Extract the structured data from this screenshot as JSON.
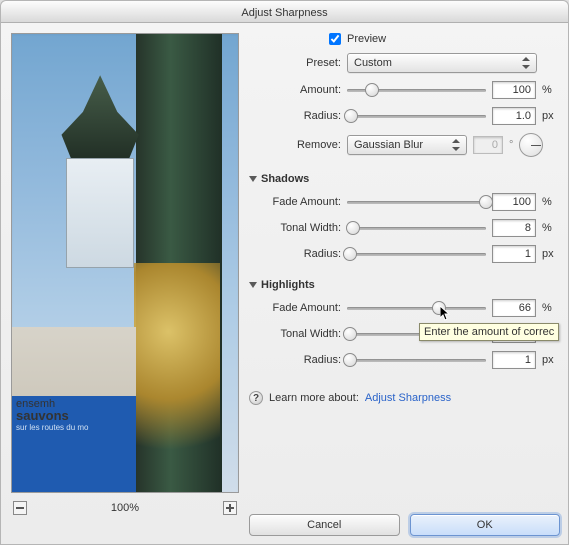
{
  "window": {
    "title": "Adjust Sharpness"
  },
  "preview": {
    "checkbox_label": "Preview",
    "banner_line1": "ensemh",
    "banner_line2": "sauvons",
    "banner_line3": "sur les routes du mo"
  },
  "zoom": {
    "level": "100%"
  },
  "preset": {
    "label": "Preset:",
    "value": "Custom"
  },
  "amount": {
    "label": "Amount:",
    "value": "100",
    "unit": "%",
    "thumb_pct": 18
  },
  "radius": {
    "label": "Radius:",
    "value": "1.0",
    "unit": "px",
    "thumb_pct": 3
  },
  "remove": {
    "label": "Remove:",
    "value": "Gaussian Blur",
    "angle": "0",
    "deg": "°"
  },
  "shadows": {
    "heading": "Shadows",
    "fade": {
      "label": "Fade Amount:",
      "value": "100",
      "unit": "%",
      "thumb_pct": 100
    },
    "tonal": {
      "label": "Tonal Width:",
      "value": "8",
      "unit": "%",
      "thumb_pct": 4
    },
    "radius": {
      "label": "Radius:",
      "value": "1",
      "unit": "px",
      "thumb_pct": 2
    }
  },
  "highlights": {
    "heading": "Highlights",
    "fade": {
      "label": "Fade Amount:",
      "value": "66",
      "unit": "%",
      "thumb_pct": 66
    },
    "tonal": {
      "label": "Tonal Width:",
      "value": "",
      "unit": "%",
      "thumb_pct": 2
    },
    "radius": {
      "label": "Radius:",
      "value": "1",
      "unit": "px",
      "thumb_pct": 2
    }
  },
  "tooltip": {
    "text": "Enter the amount of correc"
  },
  "learn": {
    "prefix": "Learn more about:",
    "link": "Adjust Sharpness"
  },
  "buttons": {
    "cancel": "Cancel",
    "ok": "OK"
  }
}
